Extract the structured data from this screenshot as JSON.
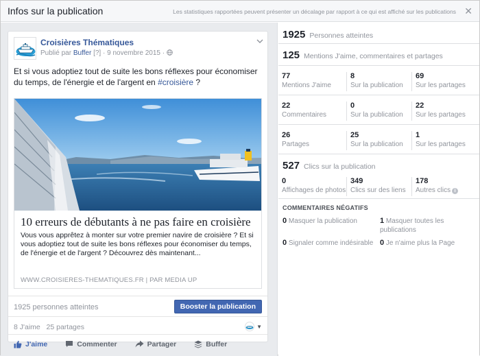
{
  "header": {
    "title": "Infos sur la publication",
    "note": "Les statistiques rapportées peuvent présenter un décalage par rapport à ce qui est affiché sur les publications",
    "close_glyph": "✕"
  },
  "post": {
    "page_name": "Croisières Thématiques",
    "published_by_prefix": "Publié par",
    "publisher": "Buffer",
    "help_mark": "[?]",
    "date": "9 novembre 2015",
    "separator": "·",
    "privacy_icon": "globe-icon",
    "text_before_tag": "Et si vous adoptiez tout de suite les bons réflexes pour économiser du temps, de l'énergie et de l'argent en",
    "hashtag": "#croisière",
    "text_after_tag": " ?",
    "link": {
      "title": "10 erreurs de débutants à ne pas faire en croisière",
      "description": "Vous vous apprêtez à monter sur votre premier navire de croisière ? Et si vous adoptiez tout de suite les bons réflexes pour économiser du temps, de l'énergie et de l'argent ? Découvrez dès maintenant...",
      "source": "WWW.CROISIERES-THEMATIQUES.FR | PAR MEDIA UP"
    },
    "reach_text": "1925 personnes atteintes",
    "boost_label": "Booster la publication",
    "likes_text": "8 J'aime   25 partages",
    "actions": {
      "like": "J'aime",
      "comment": "Commenter",
      "share": "Partager",
      "buffer": "Buffer"
    }
  },
  "stats": {
    "reach": {
      "value": "1925",
      "label": "Personnes atteintes"
    },
    "engagement": {
      "value": "125",
      "label": "Mentions J'aime, commentaires et partages"
    },
    "rows": [
      [
        {
          "value": "77",
          "label": "Mentions J'aime"
        },
        {
          "value": "8",
          "label": "Sur la publication"
        },
        {
          "value": "69",
          "label": "Sur les partages"
        }
      ],
      [
        {
          "value": "22",
          "label": "Commentaires"
        },
        {
          "value": "0",
          "label": "Sur la publication"
        },
        {
          "value": "22",
          "label": "Sur les partages"
        }
      ],
      [
        {
          "value": "26",
          "label": "Partages"
        },
        {
          "value": "25",
          "label": "Sur la publication"
        },
        {
          "value": "1",
          "label": "Sur les partages"
        }
      ]
    ],
    "clicks": {
      "value": "527",
      "label": "Clics sur la publication"
    },
    "click_cells": [
      {
        "value": "0",
        "label": "Affichages de photos"
      },
      {
        "value": "349",
        "label": "Clics sur des liens"
      },
      {
        "value": "178",
        "label": "Autres clics"
      }
    ],
    "negative": {
      "title": "COMMENTAIRES NÉGATIFS",
      "items": [
        {
          "value": "0",
          "label": "Masquer la publication"
        },
        {
          "value": "1",
          "label": "Masquer toutes les publications"
        },
        {
          "value": "0",
          "label": "Signaler comme indésirable"
        },
        {
          "value": "0",
          "label": "Je n'aime plus la Page"
        }
      ]
    }
  },
  "colors": {
    "brand_blue": "#4267b2",
    "link_blue": "#365899",
    "muted_gray": "#90949c"
  }
}
